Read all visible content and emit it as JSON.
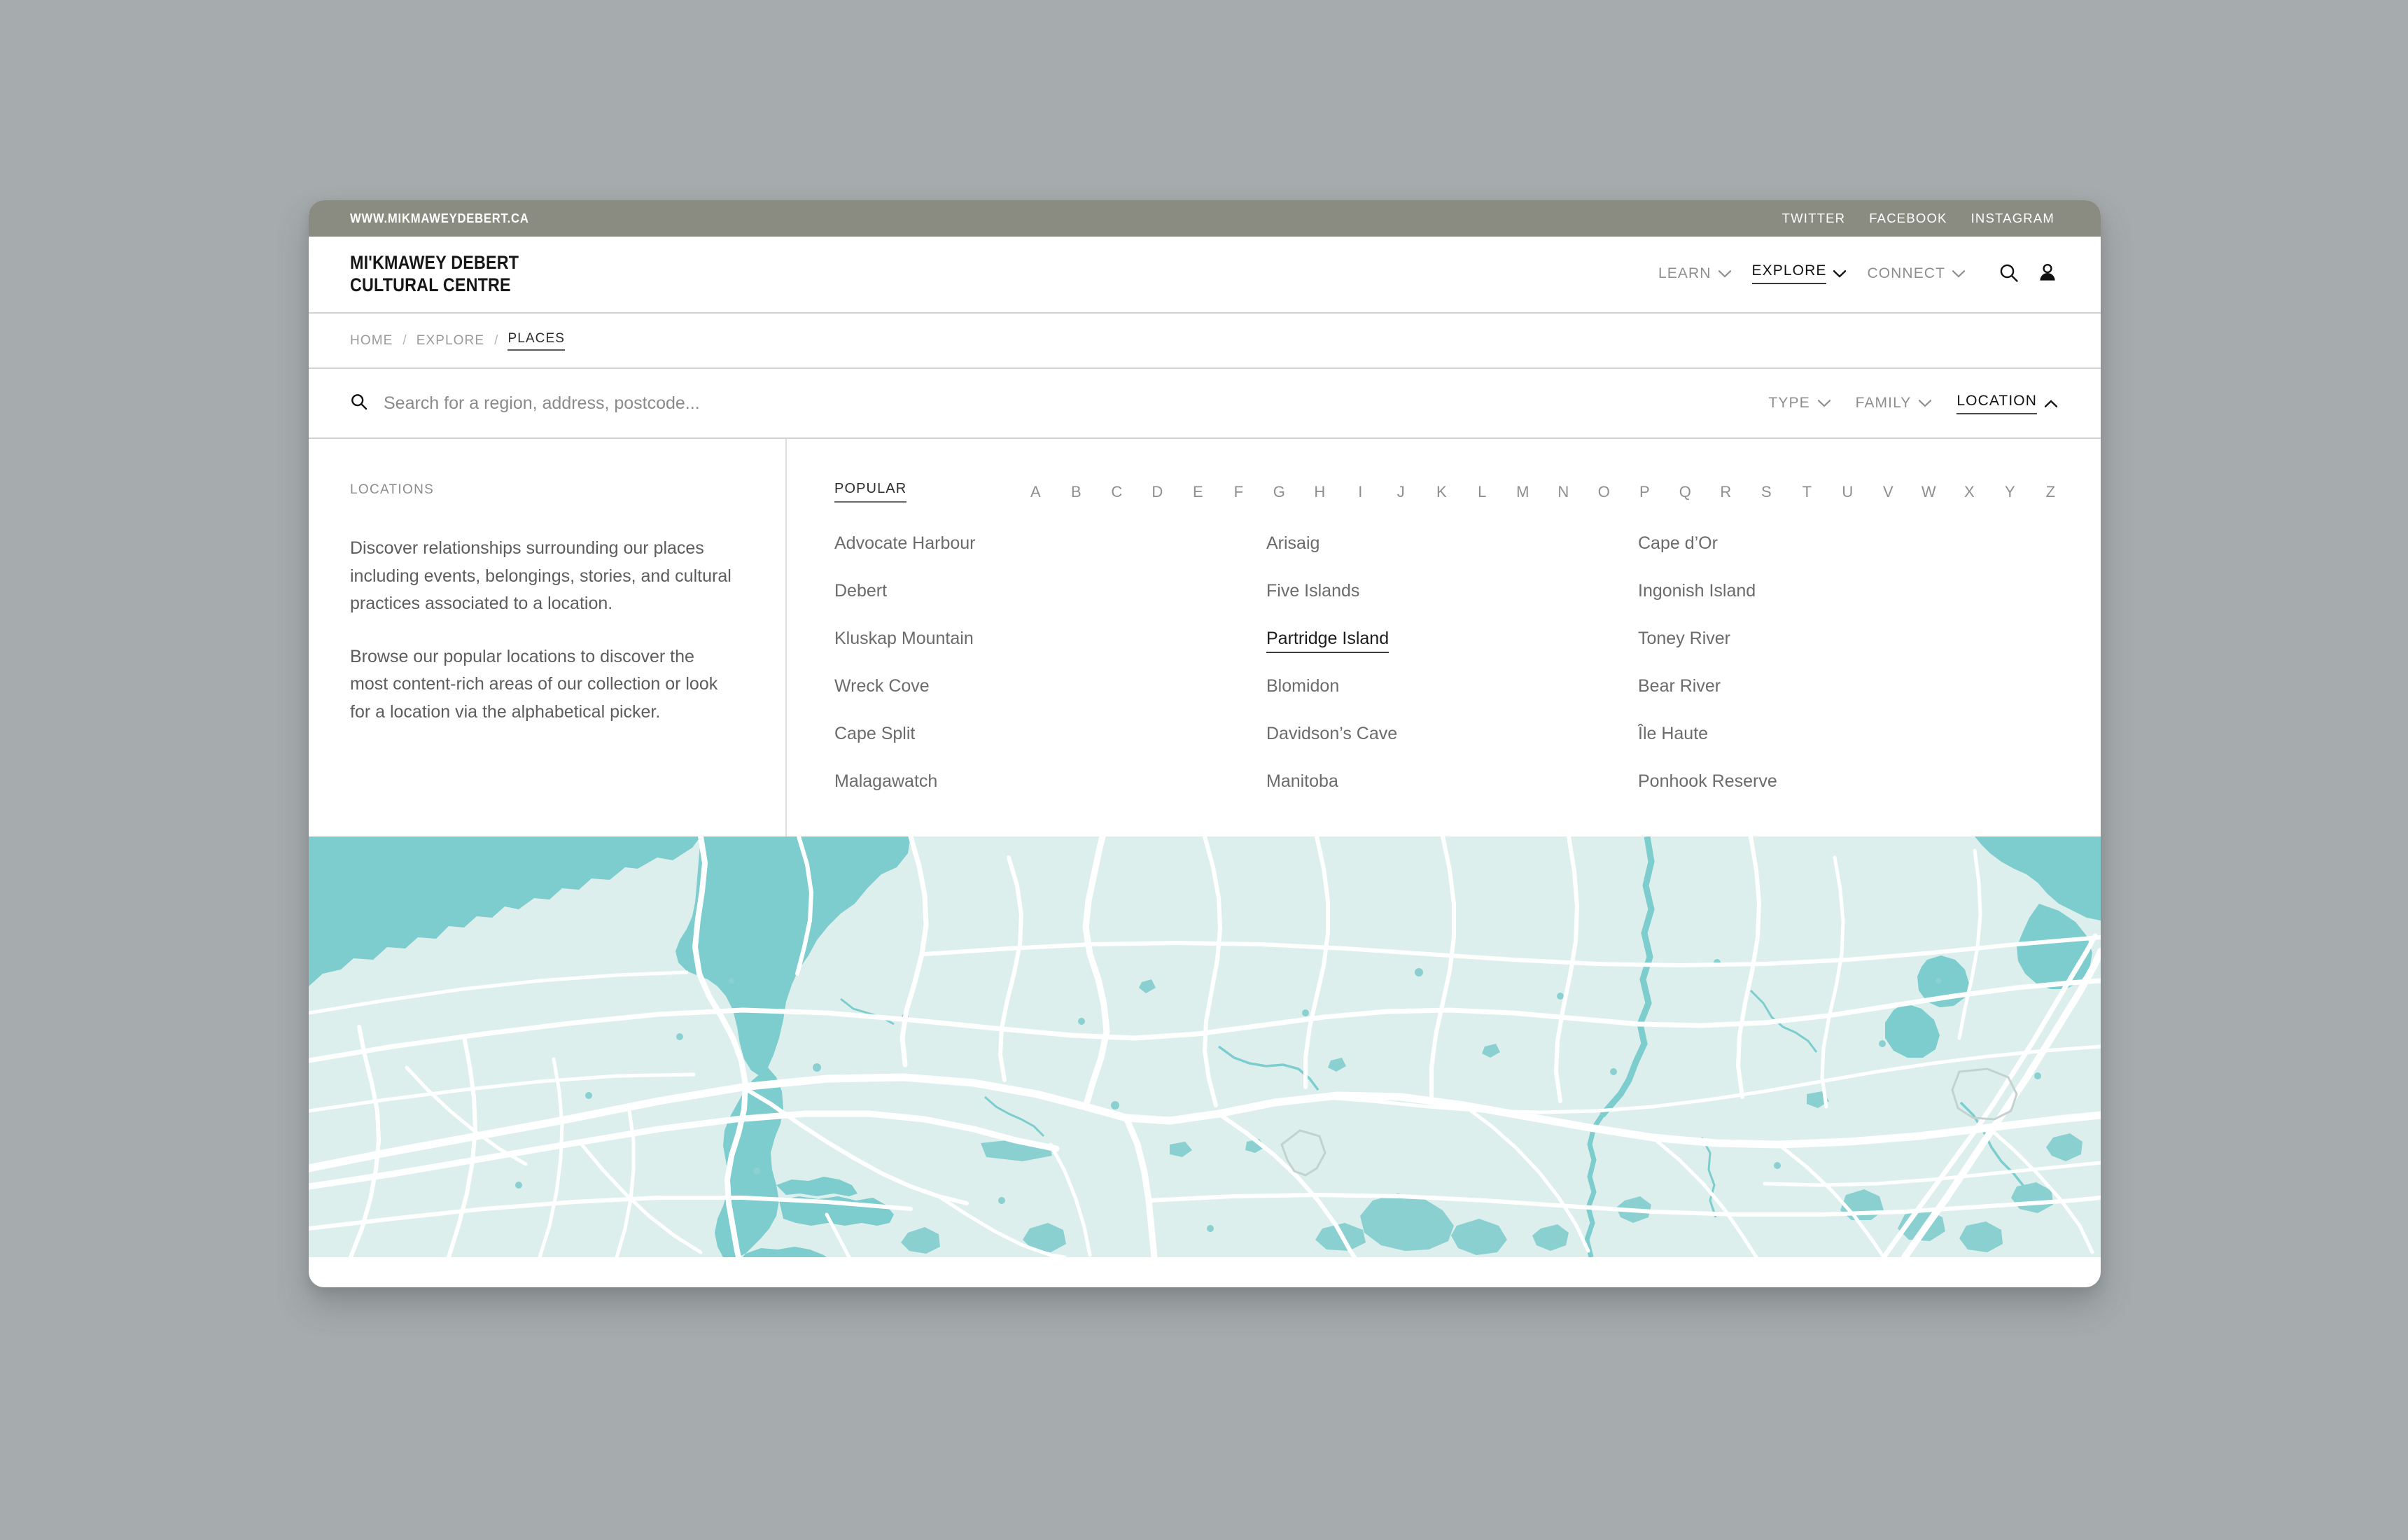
{
  "utility_bar": {
    "url": "WWW.MIKMAWEYDEBERT.CA",
    "social": [
      "TWITTER",
      "FACEBOOK",
      "INSTAGRAM"
    ]
  },
  "masthead": {
    "brand_line1": "MI'KMAWEY DEBERT",
    "brand_line2": "CULTURAL CENTRE",
    "nav": [
      {
        "label": "LEARN",
        "active": false,
        "icon": "chevron-down-icon"
      },
      {
        "label": "EXPLORE",
        "active": true,
        "icon": "chevron-down-icon"
      },
      {
        "label": "CONNECT",
        "active": false,
        "icon": "chevron-down-icon"
      }
    ],
    "icons": [
      "search-icon",
      "account-icon"
    ]
  },
  "breadcrumb": {
    "items": [
      "HOME",
      "EXPLORE",
      "PLACES"
    ],
    "separator": "/",
    "current_index": 2
  },
  "search": {
    "icon": "search-icon",
    "value": "",
    "placeholder": "Search for a region, address, postcode...",
    "filters": [
      {
        "label": "TYPE",
        "active": false,
        "icon": "chevron-down-icon"
      },
      {
        "label": "FAMILY",
        "active": false,
        "icon": "chevron-down-icon"
      },
      {
        "label": "LOCATION",
        "active": true,
        "icon": "chevron-up-icon"
      }
    ]
  },
  "panel": {
    "heading": "LOCATIONS",
    "paragraph1": "Discover relationships surrounding our places including events, belongings, stories, and cultural practices associated to a location.",
    "paragraph2": "Browse our popular locations to discover the most content-rich areas of our collection or look for a location via the alphabetical picker.",
    "popular_tab": "POPULAR",
    "alphabet": [
      "A",
      "B",
      "C",
      "D",
      "E",
      "F",
      "G",
      "H",
      "I",
      "J",
      "K",
      "L",
      "M",
      "N",
      "O",
      "P",
      "Q",
      "R",
      "S",
      "T",
      "U",
      "V",
      "W",
      "X",
      "Y",
      "Z"
    ],
    "locations": [
      {
        "name": "Advocate Harbour",
        "active": false
      },
      {
        "name": "Arisaig",
        "active": false
      },
      {
        "name": "Cape d’Or",
        "active": false
      },
      {
        "name": "Debert",
        "active": false
      },
      {
        "name": "Five Islands",
        "active": false
      },
      {
        "name": "Ingonish Island",
        "active": false
      },
      {
        "name": "Kluskap Mountain",
        "active": false
      },
      {
        "name": "Partridge Island",
        "active": true
      },
      {
        "name": "Toney River",
        "active": false
      },
      {
        "name": "Wreck Cove",
        "active": false
      },
      {
        "name": "Blomidon",
        "active": false
      },
      {
        "name": "Bear River",
        "active": false
      },
      {
        "name": "Cape Split",
        "active": false
      },
      {
        "name": "Davidson’s Cave",
        "active": false
      },
      {
        "name": "Île Haute",
        "active": false
      },
      {
        "name": "Malagawatch",
        "active": false
      },
      {
        "name": "Manitoba",
        "active": false
      },
      {
        "name": "Ponhook Reserve",
        "active": false
      }
    ]
  },
  "map": {
    "label": "locations-map",
    "colors": {
      "water": "#7ecdce",
      "land": "#dcefed",
      "road": "#ffffff",
      "inland_water": "#8bd0d1"
    }
  },
  "colors": {
    "page_background": "#a6abad",
    "utility_bar": "#8b8c81",
    "accent_text": "#131313",
    "muted_text": "#8e8e8e",
    "body_text": "#5d5d5d"
  }
}
